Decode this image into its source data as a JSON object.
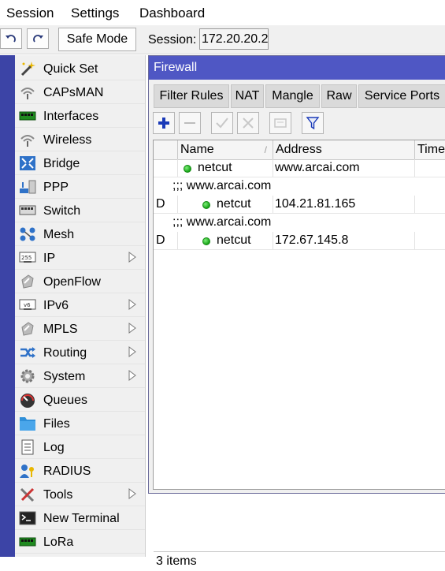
{
  "menubar": {
    "session": "Session",
    "settings": "Settings",
    "dashboard": "Dashboard"
  },
  "toolbar": {
    "safe_mode": "Safe Mode",
    "session_label": "Session:",
    "session_value": "172.20.20.2"
  },
  "sidebar": {
    "items": [
      {
        "label": "Quick Set",
        "icon": "wand-icon",
        "submenu": false
      },
      {
        "label": "CAPsMAN",
        "icon": "wireless-antenna-icon",
        "submenu": false
      },
      {
        "label": "Interfaces",
        "icon": "network-card-icon",
        "submenu": false
      },
      {
        "label": "Wireless",
        "icon": "wireless-antenna-icon",
        "submenu": false
      },
      {
        "label": "Bridge",
        "icon": "bridge-icon",
        "submenu": false
      },
      {
        "label": "PPP",
        "icon": "ppp-icon",
        "submenu": false
      },
      {
        "label": "Switch",
        "icon": "switch-icon",
        "submenu": false
      },
      {
        "label": "Mesh",
        "icon": "mesh-icon",
        "submenu": false
      },
      {
        "label": "IP",
        "icon": "ip-icon",
        "submenu": true
      },
      {
        "label": "OpenFlow",
        "icon": "openflow-icon",
        "submenu": false
      },
      {
        "label": "IPv6",
        "icon": "ipv6-icon",
        "submenu": true
      },
      {
        "label": "MPLS",
        "icon": "mpls-icon",
        "submenu": true
      },
      {
        "label": "Routing",
        "icon": "routing-icon",
        "submenu": true
      },
      {
        "label": "System",
        "icon": "gear-icon",
        "submenu": true
      },
      {
        "label": "Queues",
        "icon": "queues-icon",
        "submenu": false
      },
      {
        "label": "Files",
        "icon": "folder-icon",
        "submenu": false
      },
      {
        "label": "Log",
        "icon": "log-icon",
        "submenu": false
      },
      {
        "label": "RADIUS",
        "icon": "radius-icon",
        "submenu": false
      },
      {
        "label": "Tools",
        "icon": "tools-icon",
        "submenu": true
      },
      {
        "label": "New Terminal",
        "icon": "terminal-icon",
        "submenu": false
      },
      {
        "label": "LoRa",
        "icon": "lora-icon",
        "submenu": false
      }
    ]
  },
  "firewall": {
    "title": "Firewall",
    "tabs": [
      "Filter Rules",
      "NAT",
      "Mangle",
      "Raw",
      "Service Ports"
    ],
    "columns": [
      "Name",
      "Address",
      "Timeo"
    ],
    "rows": [
      {
        "type": "entry",
        "flag": "",
        "name": "netcut",
        "address": "www.arcai.com"
      },
      {
        "type": "comment",
        "text": ";;; www.arcai.com"
      },
      {
        "type": "entry",
        "flag": "D",
        "name": "netcut",
        "address": "104.21.81.165"
      },
      {
        "type": "comment",
        "text": ";;; www.arcai.com"
      },
      {
        "type": "entry",
        "flag": "D",
        "name": "netcut",
        "address": "172.67.145.8"
      }
    ],
    "status": "3 items"
  },
  "colors": {
    "title_bar": "#4f57c4",
    "left_strip": "#3c44a6",
    "status_dot": "#17a317"
  }
}
